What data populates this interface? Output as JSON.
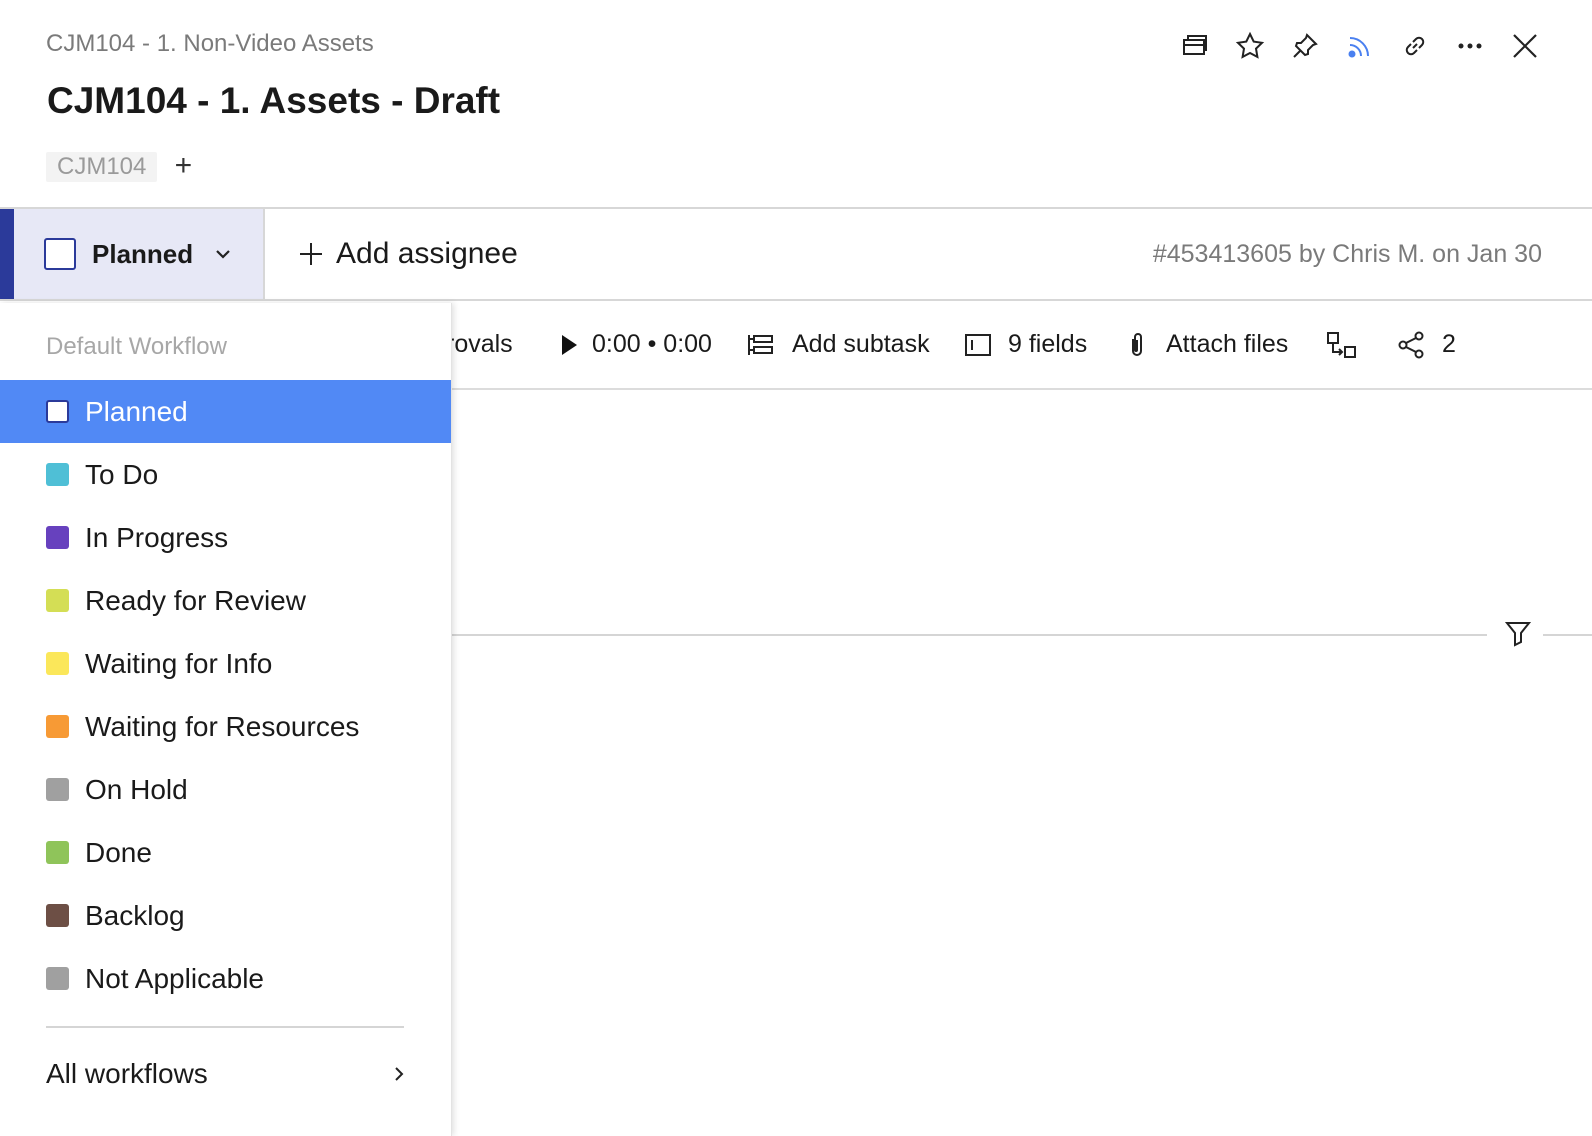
{
  "header": {
    "breadcrumb": "CJM104 - 1. Non-Video Assets",
    "title": "CJM104 - 1. Assets - Draft",
    "tag": "CJM104",
    "tag_add": "+"
  },
  "status_bar": {
    "status_label": "Planned",
    "add_assignee": "Add assignee",
    "meta": "#453413605 by Chris M. on Jan 30"
  },
  "toolbar": {
    "approvals_partial": "rovals",
    "timer": "0:00 • 0:00",
    "add_subtask": "Add subtask",
    "fields": "9 fields",
    "attach_files": "Attach files",
    "share_count": "2"
  },
  "dropdown": {
    "section_title": "Default Workflow",
    "items": [
      {
        "label": "Planned",
        "color": "#ffffff",
        "selected": true
      },
      {
        "label": "To Do",
        "color": "#4fbfd6"
      },
      {
        "label": "In Progress",
        "color": "#6741be"
      },
      {
        "label": "Ready for Review",
        "color": "#d4de55"
      },
      {
        "label": "Waiting for Info",
        "color": "#fbe75a"
      },
      {
        "label": "Waiting for Resources",
        "color": "#f79a35"
      },
      {
        "label": "On Hold",
        "color": "#a0a0a0"
      },
      {
        "label": "Done",
        "color": "#8fc45a"
      },
      {
        "label": "Backlog",
        "color": "#6d4f45"
      },
      {
        "label": "Not Applicable",
        "color": "#a0a0a0"
      }
    ],
    "all_workflows": "All workflows"
  },
  "colors": {
    "accent": "#2b3a9a",
    "selected_bg": "#5189f5",
    "rss_blue": "#4a80f0"
  }
}
